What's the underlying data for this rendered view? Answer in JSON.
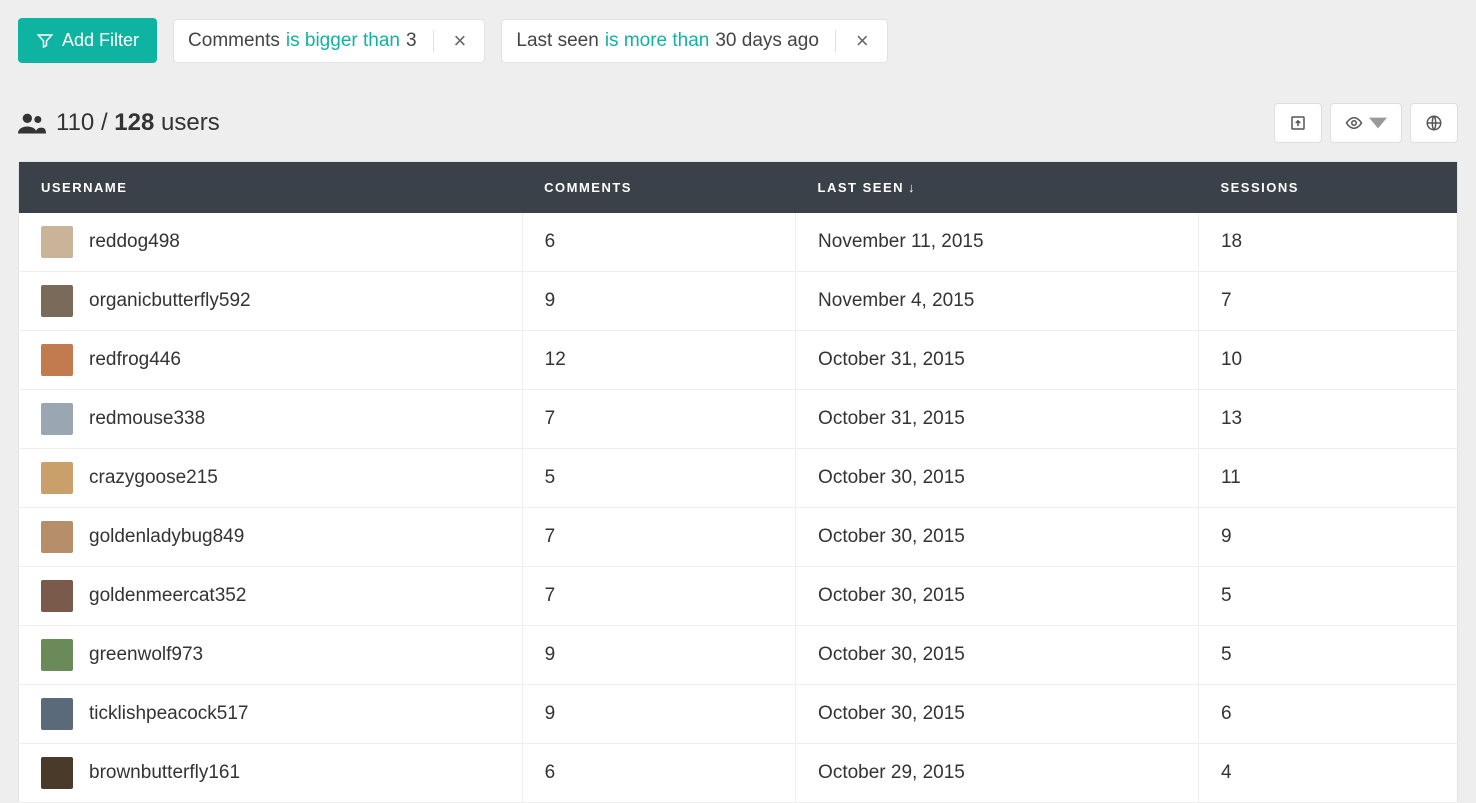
{
  "filters": {
    "add_label": "Add Filter",
    "chips": [
      {
        "field": "Comments",
        "op": "is bigger than",
        "value": "3"
      },
      {
        "field": "Last seen",
        "op": "is more than",
        "value": "30 days ago"
      }
    ]
  },
  "summary": {
    "shown": "110",
    "separator": "/",
    "total": "128",
    "entity": "users"
  },
  "columns": {
    "username": "USERNAME",
    "comments": "COMMENTS",
    "last_seen": "LAST SEEN",
    "sort_arrow": "↓",
    "sessions": "SESSIONS"
  },
  "rows": [
    {
      "username": "reddog498",
      "comments": "6",
      "last_seen": "November 11, 2015",
      "sessions": "18",
      "avatar_color": "#c9b49a"
    },
    {
      "username": "organicbutterfly592",
      "comments": "9",
      "last_seen": "November 4, 2015",
      "sessions": "7",
      "avatar_color": "#7a6a5a"
    },
    {
      "username": "redfrog446",
      "comments": "12",
      "last_seen": "October 31, 2015",
      "sessions": "10",
      "avatar_color": "#c27a4f"
    },
    {
      "username": "redmouse338",
      "comments": "7",
      "last_seen": "October 31, 2015",
      "sessions": "13",
      "avatar_color": "#9aa7b3"
    },
    {
      "username": "crazygoose215",
      "comments": "5",
      "last_seen": "October 30, 2015",
      "sessions": "11",
      "avatar_color": "#caa06a"
    },
    {
      "username": "goldenladybug849",
      "comments": "7",
      "last_seen": "October 30, 2015",
      "sessions": "9",
      "avatar_color": "#b68e6a"
    },
    {
      "username": "goldenmeercat352",
      "comments": "7",
      "last_seen": "October 30, 2015",
      "sessions": "5",
      "avatar_color": "#7a5a4a"
    },
    {
      "username": "greenwolf973",
      "comments": "9",
      "last_seen": "October 30, 2015",
      "sessions": "5",
      "avatar_color": "#6a8a5a"
    },
    {
      "username": "ticklishpeacock517",
      "comments": "9",
      "last_seen": "October 30, 2015",
      "sessions": "6",
      "avatar_color": "#5a6a7a"
    },
    {
      "username": "brownbutterfly161",
      "comments": "6",
      "last_seen": "October 29, 2015",
      "sessions": "4",
      "avatar_color": "#4a3a2a"
    }
  ]
}
